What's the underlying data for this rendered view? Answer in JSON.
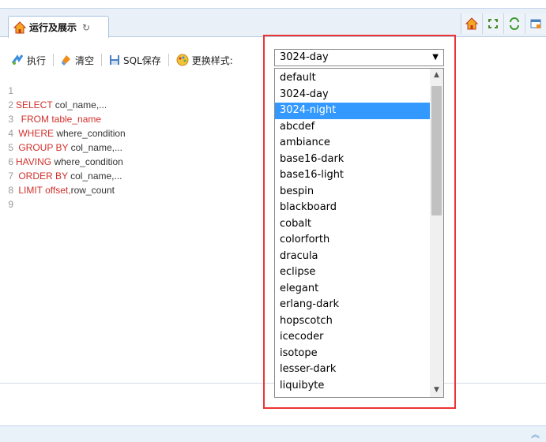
{
  "tab": {
    "label": "运行及展示",
    "refresh_glyph": "↻"
  },
  "toolbar": {
    "execute": "执行",
    "clear": "清空",
    "save": "SQL保存",
    "style_label": "更换样式:"
  },
  "editor": {
    "lines": [
      {
        "n": "1",
        "kw": "",
        "tx": ""
      },
      {
        "n": "2",
        "kw": "SELECT",
        "tx": " col_name,..."
      },
      {
        "n": "3",
        "kw": "  FROM table_name",
        "tx": ""
      },
      {
        "n": "4",
        "kw": " WHERE",
        "tx": " where_condition"
      },
      {
        "n": "5",
        "kw": " GROUP BY",
        "tx": " col_name,..."
      },
      {
        "n": "6",
        "kw": "HAVING",
        "tx": " where_condition"
      },
      {
        "n": "7",
        "kw": " ORDER BY",
        "tx": " col_name,..."
      },
      {
        "n": "8",
        "kw": " LIMIT offset,",
        "tx": "row_count"
      },
      {
        "n": "9",
        "kw": "",
        "tx": ""
      }
    ]
  },
  "style_select": {
    "value": "3024-day",
    "options": [
      "default",
      "3024-day",
      "3024-night",
      "abcdef",
      "ambiance",
      "base16-dark",
      "base16-light",
      "bespin",
      "blackboard",
      "cobalt",
      "colorforth",
      "dracula",
      "eclipse",
      "elegant",
      "erlang-dark",
      "hopscotch",
      "icecoder",
      "isotope",
      "lesser-dark",
      "liquibyte"
    ],
    "highlighted": "3024-night"
  },
  "colors": {
    "accent": "#3399ff",
    "keyword": "#d0302d",
    "highlight_frame": "#ee3333"
  },
  "icons": [
    "home-icon",
    "refresh-icon",
    "fullscreen-icon",
    "reload-icon",
    "panel-icon",
    "execute-icon",
    "clear-icon",
    "save-icon",
    "palette-icon",
    "collapse-up-icon"
  ]
}
